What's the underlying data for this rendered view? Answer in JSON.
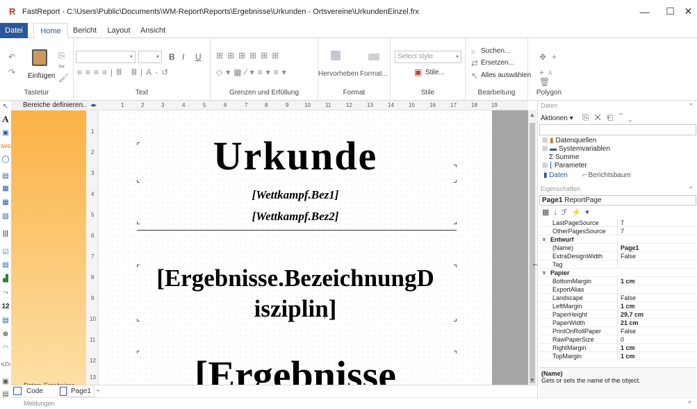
{
  "window": {
    "title": "FastReport - C:\\Users\\Public\\Documents\\WM-Report\\Reports\\Ergebnisse\\Urkunden - Ortsvereine\\UrkundenEinzel.frx",
    "minimize": "—",
    "maximize": "☐",
    "close": "✕"
  },
  "menu": {
    "tabs": [
      "Datei",
      "Home",
      "Bericht",
      "Layout",
      "Ansicht"
    ]
  },
  "ribbon": {
    "groups": {
      "clipboard": "Tastetur",
      "text": "Text",
      "borders": "Grenzen und Erfüllung",
      "format": "Format",
      "styles": "Stile",
      "edit": "Bearbeitung",
      "polygon": "Polygon"
    },
    "paste_label": "Einfügen",
    "highlight_label": "Hervorheben",
    "format_label": "Format...",
    "style_select_placeholder": "Select style",
    "styles_button": "Stile...",
    "search_label": "Suchen...",
    "replace_label": "Ersetzen...",
    "select_all_label": "Alles auswählen",
    "bold": "B",
    "italic": "I",
    "underline": "U"
  },
  "bands_panel": {
    "header": "Bereiche definieren...",
    "footer": "Daten: Ergebnisse"
  },
  "ruler": {
    "h_ticks": [
      "1",
      "2",
      "3",
      "4",
      "5",
      "6",
      "7",
      "8",
      "9",
      "10",
      "11",
      "12",
      "13",
      "14",
      "15",
      "16",
      "17",
      "18",
      "19"
    ],
    "v_ticks": [
      "1",
      "2",
      "3",
      "4",
      "5",
      "6",
      "7",
      "8",
      "9",
      "10",
      "11",
      "12",
      "13"
    ]
  },
  "report": {
    "title": "Urkunde",
    "field1": "[Wettkampf.Bez1]",
    "field2": "[Wettkampf.Bez2]",
    "discipline_line1": "[Ergebnisse.BezeichnungD",
    "discipline_line2": "isziplin]",
    "big_partial": "[Ergebnisse"
  },
  "bottom_tabs": {
    "code": "Code",
    "page": "Page1",
    "add": "+"
  },
  "messages_label": "Meldungen",
  "data_panel": {
    "header": "Daten",
    "actions": "Aktionen",
    "tree": [
      "Datenquellen",
      "Systemvariablen",
      "Summe",
      "Parameter"
    ],
    "tab_data": "Daten",
    "tab_tree": "Berichtsbaum"
  },
  "properties_panel": {
    "header": "Eigenschaften",
    "object_name": "Page1",
    "object_type": "ReportPage",
    "rows": [
      {
        "name": "LastPageSource",
        "value": "7",
        "kind": "prop"
      },
      {
        "name": "OtherPagesSource",
        "value": "7",
        "kind": "prop"
      },
      {
        "name": "Entwurf",
        "value": "",
        "kind": "cat"
      },
      {
        "name": "(Name)",
        "value": "Page1",
        "kind": "bold"
      },
      {
        "name": "ExtraDesignWidth",
        "value": "False",
        "kind": "prop"
      },
      {
        "name": "Tag",
        "value": "",
        "kind": "prop"
      },
      {
        "name": "Papier",
        "value": "",
        "kind": "cat"
      },
      {
        "name": "BottomMargin",
        "value": "1 cm",
        "kind": "bold"
      },
      {
        "name": "ExportAlias",
        "value": "",
        "kind": "prop"
      },
      {
        "name": "Landscape",
        "value": "False",
        "kind": "prop"
      },
      {
        "name": "LeftMargin",
        "value": "1 cm",
        "kind": "bold"
      },
      {
        "name": "PaperHeight",
        "value": "29,7 cm",
        "kind": "bold"
      },
      {
        "name": "PaperWidth",
        "value": "21 cm",
        "kind": "bold"
      },
      {
        "name": "PrintOnRollPaper",
        "value": "False",
        "kind": "prop"
      },
      {
        "name": "RawPaperSize",
        "value": "0",
        "kind": "prop"
      },
      {
        "name": "RightMargin",
        "value": "1 cm",
        "kind": "bold"
      },
      {
        "name": "TopMargin",
        "value": "1 cm",
        "kind": "bold"
      }
    ],
    "desc_title": "(Name)",
    "desc_text": "Gets or sets the name of the object."
  },
  "colors": {
    "accent": "#2b579a",
    "band": "#fbb040"
  }
}
